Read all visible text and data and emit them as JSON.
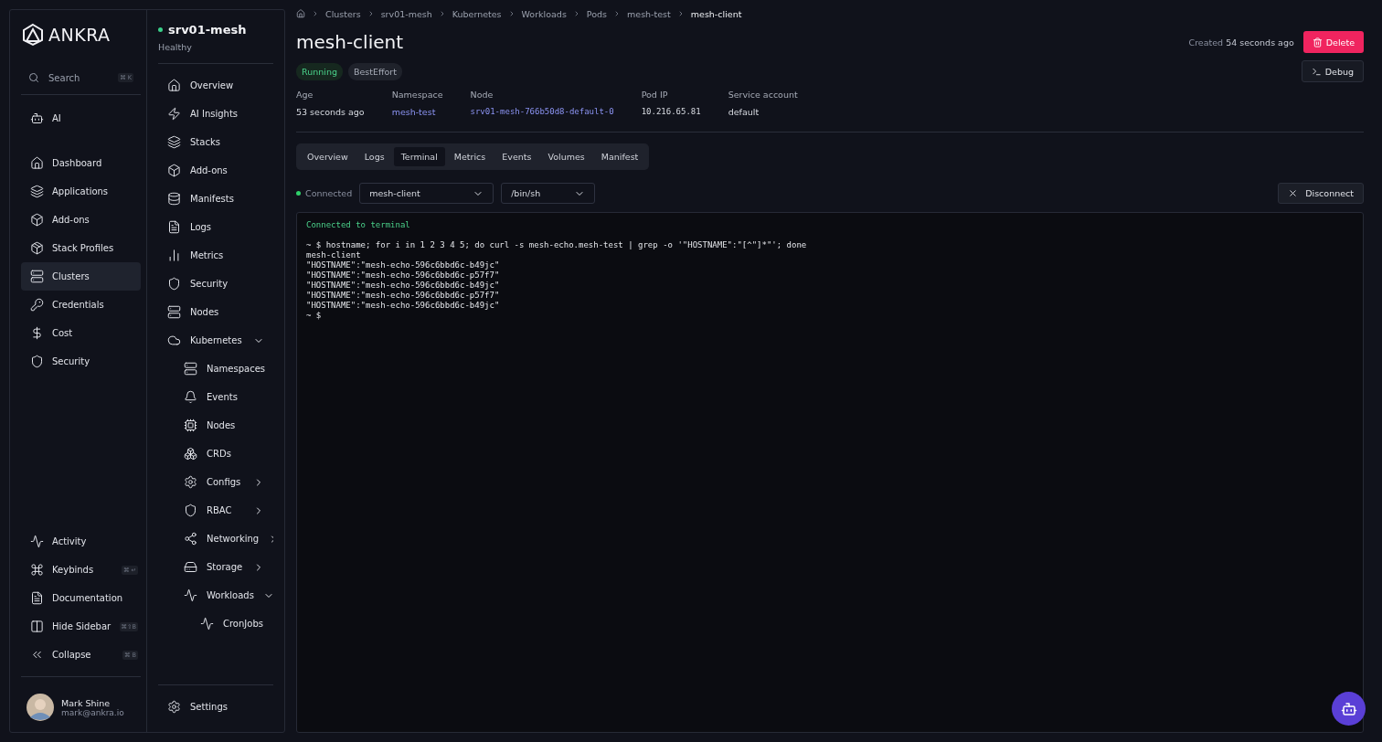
{
  "brand": {
    "name": "ANKRA"
  },
  "nav": {
    "search": {
      "placeholder": "Search",
      "shortcut": "⌘ K"
    },
    "top": [
      {
        "label": "AI",
        "selected": false
      }
    ],
    "items": [
      {
        "label": "Dashboard",
        "selected": false
      },
      {
        "label": "Applications",
        "selected": false
      },
      {
        "label": "Add-ons",
        "selected": false
      },
      {
        "label": "Stack Profiles",
        "selected": false
      },
      {
        "label": "Clusters",
        "selected": true
      },
      {
        "label": "Credentials",
        "selected": false
      },
      {
        "label": "Cost",
        "selected": false
      },
      {
        "label": "Security",
        "selected": false
      }
    ],
    "bottom": [
      {
        "label": "Activity"
      },
      {
        "label": "Keybinds",
        "shortcut": "⌘ ↵"
      },
      {
        "label": "Documentation"
      },
      {
        "label": "Hide Sidebar",
        "shortcut": "⌘⇧B"
      },
      {
        "label": "Collapse",
        "shortcut": "⌘ B"
      }
    ],
    "user": {
      "name": "Mark Shine",
      "email": "mark@ankra.io"
    }
  },
  "cluster": {
    "name": "srv01-mesh",
    "status": "Healthy",
    "healthy": true,
    "items": [
      {
        "label": "Overview"
      },
      {
        "label": "AI Insights"
      },
      {
        "label": "Stacks"
      },
      {
        "label": "Add-ons"
      },
      {
        "label": "Manifests"
      },
      {
        "label": "Logs"
      },
      {
        "label": "Metrics"
      },
      {
        "label": "Security"
      },
      {
        "label": "Nodes"
      },
      {
        "label": "Kubernetes",
        "expanded": true,
        "children": [
          {
            "label": "Namespaces"
          },
          {
            "label": "Events"
          },
          {
            "label": "Nodes"
          },
          {
            "label": "CRDs"
          },
          {
            "label": "Configs",
            "expanded": false
          },
          {
            "label": "RBAC",
            "expanded": false
          },
          {
            "label": "Networking",
            "expanded": false
          },
          {
            "label": "Storage",
            "expanded": false
          },
          {
            "label": "Workloads",
            "expanded": true,
            "children": [
              {
                "label": "CronJobs"
              }
            ]
          }
        ]
      }
    ],
    "settings": {
      "label": "Settings"
    }
  },
  "breadcrumbs": [
    "Clusters",
    "srv01-mesh",
    "Kubernetes",
    "Workloads",
    "Pods",
    "mesh-test",
    "mesh-client"
  ],
  "pod": {
    "title": "mesh-client",
    "badges": [
      {
        "label": "Running",
        "kind": "status"
      },
      {
        "label": "BestEffort",
        "kind": "plain"
      }
    ],
    "created_label": "Created",
    "created_value": "54 seconds ago",
    "delete": "Delete",
    "debug": "Debug",
    "details": [
      {
        "label": "Age",
        "value": "53 seconds ago",
        "kind": "text"
      },
      {
        "label": "Namespace",
        "value": "mesh-test",
        "kind": "link"
      },
      {
        "label": "Node",
        "value": "srv01-mesh-766b50d8-default-0",
        "kind": "mono-link"
      },
      {
        "label": "Pod IP",
        "value": "10.216.65.81",
        "kind": "mono"
      },
      {
        "label": "Service account",
        "value": "default",
        "kind": "text"
      }
    ]
  },
  "tabs": [
    {
      "label": "Overview",
      "selected": false
    },
    {
      "label": "Logs",
      "selected": false
    },
    {
      "label": "Terminal",
      "selected": true
    },
    {
      "label": "Metrics",
      "selected": false
    },
    {
      "label": "Events",
      "selected": false
    },
    {
      "label": "Volumes",
      "selected": false
    },
    {
      "label": "Manifest",
      "selected": false
    }
  ],
  "session": {
    "status": "Connected",
    "connected": true,
    "container": "mesh-client",
    "shell": "/bin/sh",
    "disconnect": "Disconnect"
  },
  "terminal": {
    "lines": [
      {
        "text": "Connected to terminal",
        "kind": "banner"
      },
      {
        "text": "~ $ hostname; for i in 1 2 3 4 5; do curl -s mesh-echo.mesh-test | grep -o '\"HOSTNAME\":\"[^\"]*\"'; done",
        "kind": "output"
      },
      {
        "text": "mesh-client",
        "kind": "output"
      },
      {
        "text": "\"HOSTNAME\":\"mesh-echo-596c6bbd6c-b49jc\"",
        "kind": "output"
      },
      {
        "text": "\"HOSTNAME\":\"mesh-echo-596c6bbd6c-p57f7\"",
        "kind": "output"
      },
      {
        "text": "\"HOSTNAME\":\"mesh-echo-596c6bbd6c-b49jc\"",
        "kind": "output"
      },
      {
        "text": "\"HOSTNAME\":\"mesh-echo-596c6bbd6c-p57f7\"",
        "kind": "output"
      },
      {
        "text": "\"HOSTNAME\":\"mesh-echo-596c6bbd6c-b49jc\"",
        "kind": "output"
      },
      {
        "text": "~ $",
        "kind": "output"
      }
    ]
  }
}
